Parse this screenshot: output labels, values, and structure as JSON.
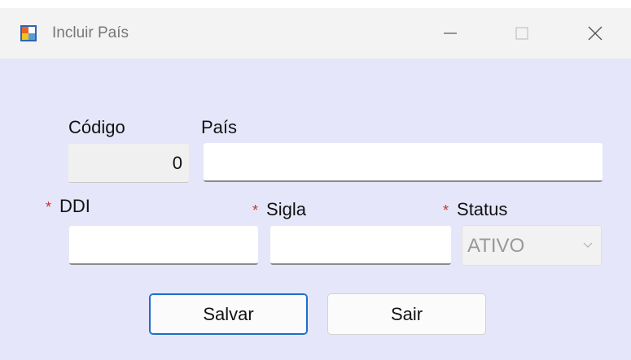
{
  "window": {
    "title": "Incluir País",
    "controls": {
      "minimize_icon": "minimize-icon",
      "maximize_icon": "maximize-icon",
      "close_icon": "close-icon"
    }
  },
  "form": {
    "codigo": {
      "label": "Código",
      "value": "0",
      "readonly": true
    },
    "pais": {
      "label": "País",
      "value": ""
    },
    "ddi": {
      "required_mark": "*",
      "label": "DDI",
      "value": ""
    },
    "sigla": {
      "required_mark": "*",
      "label": "Sigla",
      "value": ""
    },
    "status": {
      "required_mark": "*",
      "label": "Status",
      "selected": "ATIVO",
      "disabled": true
    }
  },
  "buttons": {
    "save_label": "Salvar",
    "exit_label": "Sair"
  },
  "colors": {
    "form_background": "#e6e6fa",
    "titlebar_background": "#f3f3f3",
    "required_mark": "#c0392b",
    "primary_button_border": "#1a6fc9"
  }
}
